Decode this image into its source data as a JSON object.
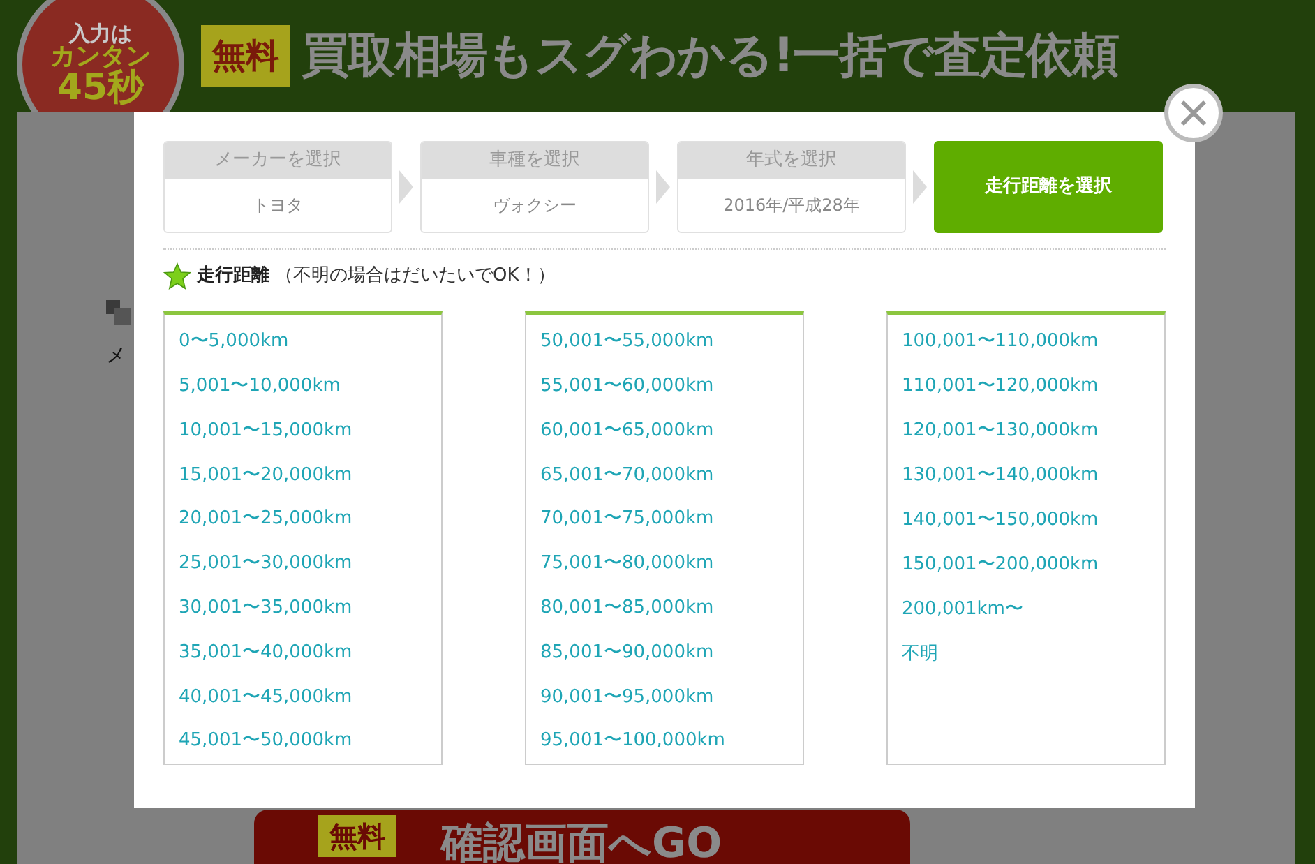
{
  "banner": {
    "badge": [
      "入力は",
      "カンタン",
      "45秒"
    ],
    "free_tag": "無料",
    "headline": "買取相場もスグわかる!一括で査定依頼"
  },
  "background": {
    "fragment": "メ",
    "cta": {
      "tag": "無料",
      "label": "確認画面へGO"
    }
  },
  "modal": {
    "steps": [
      {
        "title": "メーカーを選択",
        "value": "トヨタ",
        "selected": false
      },
      {
        "title": "車種を選択",
        "value": "ヴォクシー",
        "selected": false
      },
      {
        "title": "年式を選択",
        "value": "2016年/平成28年",
        "selected": false
      },
      {
        "title": "走行距離を選択",
        "selected": true
      }
    ],
    "heading": "走行距離",
    "note": "（不明の場合はだいたいでOK！）",
    "columns": [
      [
        "0〜5,000km",
        "5,001〜10,000km",
        "10,001〜15,000km",
        "15,001〜20,000km",
        "20,001〜25,000km",
        "25,001〜30,000km",
        "30,001〜35,000km",
        "35,001〜40,000km",
        "40,001〜45,000km",
        "45,001〜50,000km"
      ],
      [
        "50,001〜55,000km",
        "55,001〜60,000km",
        "60,001〜65,000km",
        "65,001〜70,000km",
        "70,001〜75,000km",
        "75,001〜80,000km",
        "80,001〜85,000km",
        "85,001〜90,000km",
        "90,001〜95,000km",
        "95,001〜100,000km"
      ],
      [
        "100,001〜110,000km",
        "110,001〜120,000km",
        "120,001〜130,000km",
        "130,001〜140,000km",
        "140,001〜150,000km",
        "150,001〜200,000km",
        "200,001km〜",
        "不明"
      ]
    ]
  }
}
